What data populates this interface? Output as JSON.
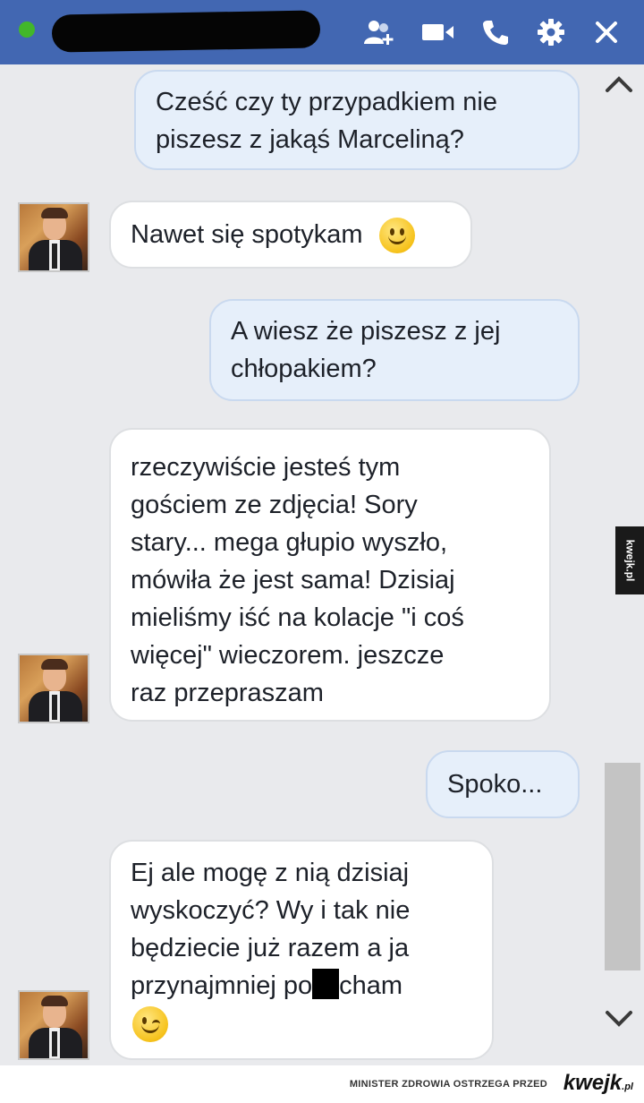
{
  "header": {
    "status": "online",
    "icons": [
      "add-person-icon",
      "video-call-icon",
      "phone-call-icon",
      "settings-gear-icon",
      "close-icon"
    ]
  },
  "messages": [
    {
      "direction": "out",
      "lines": [
        "Cześć czy ty przypadkiem nie",
        "piszesz z jakąś Marceliną?"
      ]
    },
    {
      "direction": "in",
      "lines": [
        "Nawet się spotykam"
      ],
      "emoji": "smile"
    },
    {
      "direction": "out",
      "lines": [
        "A wiesz że piszesz z jej",
        "chłopakiem?"
      ]
    },
    {
      "direction": "in",
      "lines": [
        "rzeczywiście jesteś tym",
        "gościem ze zdjęcia! Sory",
        "stary... mega głupio wyszło,",
        "mówiła że jest sama! Dzisiaj",
        "mieliśmy iść na kolacje \"i coś",
        "więcej\" wieczorem. jeszcze",
        "raz przepraszam"
      ]
    },
    {
      "direction": "out",
      "lines": [
        "Spoko..."
      ]
    },
    {
      "direction": "in",
      "lines": [
        "Ej ale mogę z nią dzisiaj",
        "wyskoczyć? Wy i tak nie",
        "będziecie już razem a ja"
      ],
      "last_line_start": "przynajmniej po",
      "last_line_end": "cham",
      "emoji": "wink"
    }
  ],
  "watermark": {
    "side": "kwejk.pl",
    "footer_text": "MINISTER ZDROWIA OSTRZEGA PRZED",
    "footer_logo": "kwejk",
    "footer_logo_suffix": ".pl"
  },
  "colors": {
    "header": "#4267b2",
    "online": "#42b72a",
    "outgoing_bubble": "#e6effa",
    "incoming_bubble": "#ffffff",
    "background": "#e9eaed"
  }
}
